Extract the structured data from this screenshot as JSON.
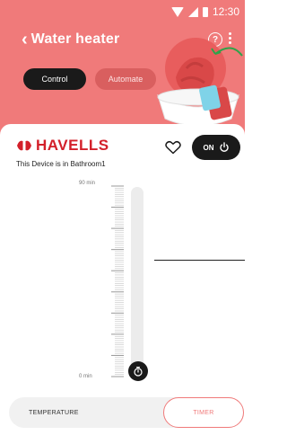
{
  "status_bar": {
    "time": "12:30"
  },
  "header": {
    "back_label": "Water heater",
    "help_icon": "help-circle-icon",
    "more_icon": "more-vertical-icon"
  },
  "tabs": [
    {
      "label": "Control",
      "active": true
    },
    {
      "label": "Automate",
      "active": false
    }
  ],
  "device": {
    "brand": "HAVELLS",
    "location_text": "This Device is in Bathroom1",
    "favorite_icon": "heart-outline-icon",
    "power_label": "ON",
    "power_icon": "power-icon"
  },
  "timer_scale": {
    "max_label": "90 min",
    "min_label": "0 min",
    "knob_icon": "stopwatch-icon"
  },
  "modes": {
    "temperature_label": "TEMPERATURE",
    "timer_label": "TIMER",
    "selected": "TIMER"
  },
  "colors": {
    "header": "#f07a7a",
    "brand_red": "#d3202a",
    "dark": "#1a1a1a",
    "accent": "#f07a7a"
  }
}
